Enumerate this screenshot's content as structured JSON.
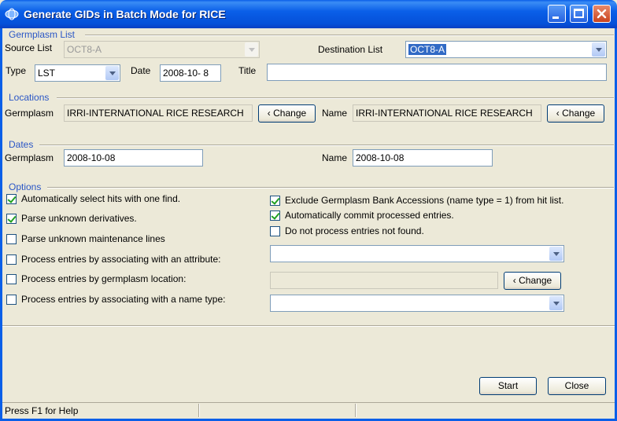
{
  "window": {
    "title": "Generate GIDs in Batch Mode for RICE"
  },
  "germplasm_list": {
    "group_label": "Germplasm List",
    "source_label": "Source List",
    "source_value": "OCT8-A",
    "destination_label": "Destination List",
    "destination_value": "OCT8-A",
    "type_label": "Type",
    "type_value": "LST",
    "date_label": "Date",
    "date_value": "2008-10- 8",
    "title_label": "Title",
    "title_value": ""
  },
  "locations": {
    "group_label": "Locations",
    "germplasm_label": "Germplasm",
    "germplasm_value": "IRRI-INTERNATIONAL RICE RESEARCH",
    "change_label": "Change",
    "name_label": "Name",
    "name_value": "IRRI-INTERNATIONAL RICE RESEARCH"
  },
  "dates": {
    "group_label": "Dates",
    "germplasm_label": "Germplasm",
    "germplasm_value": "2008-10-08",
    "name_label": "Name",
    "name_value": "2008-10-08"
  },
  "options": {
    "group_label": "Options",
    "auto_select": {
      "label": "Automatically select hits with one find.",
      "checked": true
    },
    "parse_derivatives": {
      "label": "Parse unknown derivatives.",
      "checked": true
    },
    "parse_maintenance": {
      "label": "Parse unknown maintenance lines",
      "checked": false
    },
    "by_attribute": {
      "label": "Process entries by associating with an attribute:",
      "checked": false
    },
    "by_location": {
      "label": "Process entries by germplasm location:",
      "checked": false
    },
    "by_name_type": {
      "label": "Process entries by associating with a name type:",
      "checked": false
    },
    "exclude_bank": {
      "label": "Exclude Germplasm Bank Accessions (name type = 1) from hit list.",
      "checked": true
    },
    "auto_commit": {
      "label": "Automatically commit processed entries.",
      "checked": true
    },
    "skip_not_found": {
      "label": "Do not process entries not found.",
      "checked": false
    },
    "change_label": "Change"
  },
  "actions": {
    "start_label": "Start",
    "close_label": "Close"
  },
  "status": {
    "help_text": "Press F1 for Help"
  }
}
